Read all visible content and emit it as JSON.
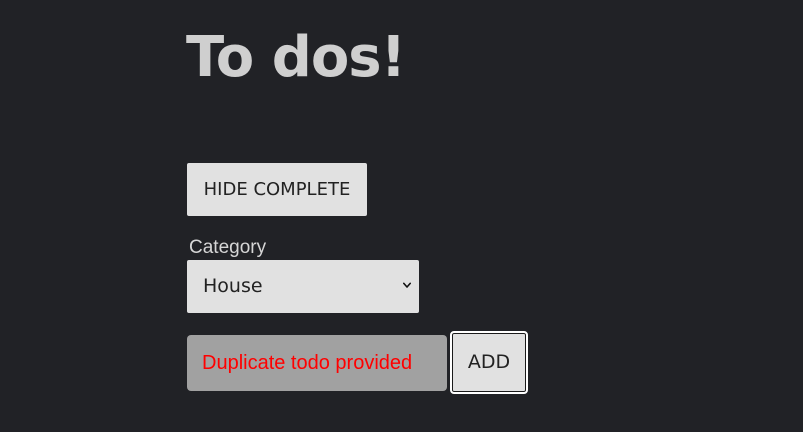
{
  "page": {
    "title": "To dos!"
  },
  "controls": {
    "hide_complete_label": "HIDE COMPLETE",
    "category_label": "Category",
    "category_selected": "House",
    "todo_input_value": "Duplicate todo provided",
    "add_label": "ADD"
  },
  "colors": {
    "background": "#212226",
    "title": "#cfcfcf",
    "button_bg": "#e1e1e1",
    "input_bg": "#a1a1a1",
    "error_text": "#ff0000"
  },
  "icons": {
    "select_chevron": "chevron-down-icon"
  }
}
